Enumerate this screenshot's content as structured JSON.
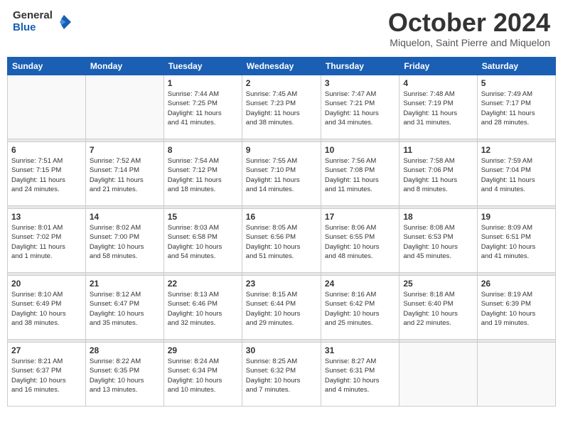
{
  "logo": {
    "general": "General",
    "blue": "Blue"
  },
  "title": "October 2024",
  "location": "Miquelon, Saint Pierre and Miquelon",
  "weekdays": [
    "Sunday",
    "Monday",
    "Tuesday",
    "Wednesday",
    "Thursday",
    "Friday",
    "Saturday"
  ],
  "weeks": [
    [
      {
        "day": "",
        "info": ""
      },
      {
        "day": "",
        "info": ""
      },
      {
        "day": "1",
        "info": "Sunrise: 7:44 AM\nSunset: 7:25 PM\nDaylight: 11 hours\nand 41 minutes."
      },
      {
        "day": "2",
        "info": "Sunrise: 7:45 AM\nSunset: 7:23 PM\nDaylight: 11 hours\nand 38 minutes."
      },
      {
        "day": "3",
        "info": "Sunrise: 7:47 AM\nSunset: 7:21 PM\nDaylight: 11 hours\nand 34 minutes."
      },
      {
        "day": "4",
        "info": "Sunrise: 7:48 AM\nSunset: 7:19 PM\nDaylight: 11 hours\nand 31 minutes."
      },
      {
        "day": "5",
        "info": "Sunrise: 7:49 AM\nSunset: 7:17 PM\nDaylight: 11 hours\nand 28 minutes."
      }
    ],
    [
      {
        "day": "6",
        "info": "Sunrise: 7:51 AM\nSunset: 7:15 PM\nDaylight: 11 hours\nand 24 minutes."
      },
      {
        "day": "7",
        "info": "Sunrise: 7:52 AM\nSunset: 7:14 PM\nDaylight: 11 hours\nand 21 minutes."
      },
      {
        "day": "8",
        "info": "Sunrise: 7:54 AM\nSunset: 7:12 PM\nDaylight: 11 hours\nand 18 minutes."
      },
      {
        "day": "9",
        "info": "Sunrise: 7:55 AM\nSunset: 7:10 PM\nDaylight: 11 hours\nand 14 minutes."
      },
      {
        "day": "10",
        "info": "Sunrise: 7:56 AM\nSunset: 7:08 PM\nDaylight: 11 hours\nand 11 minutes."
      },
      {
        "day": "11",
        "info": "Sunrise: 7:58 AM\nSunset: 7:06 PM\nDaylight: 11 hours\nand 8 minutes."
      },
      {
        "day": "12",
        "info": "Sunrise: 7:59 AM\nSunset: 7:04 PM\nDaylight: 11 hours\nand 4 minutes."
      }
    ],
    [
      {
        "day": "13",
        "info": "Sunrise: 8:01 AM\nSunset: 7:02 PM\nDaylight: 11 hours\nand 1 minute."
      },
      {
        "day": "14",
        "info": "Sunrise: 8:02 AM\nSunset: 7:00 PM\nDaylight: 10 hours\nand 58 minutes."
      },
      {
        "day": "15",
        "info": "Sunrise: 8:03 AM\nSunset: 6:58 PM\nDaylight: 10 hours\nand 54 minutes."
      },
      {
        "day": "16",
        "info": "Sunrise: 8:05 AM\nSunset: 6:56 PM\nDaylight: 10 hours\nand 51 minutes."
      },
      {
        "day": "17",
        "info": "Sunrise: 8:06 AM\nSunset: 6:55 PM\nDaylight: 10 hours\nand 48 minutes."
      },
      {
        "day": "18",
        "info": "Sunrise: 8:08 AM\nSunset: 6:53 PM\nDaylight: 10 hours\nand 45 minutes."
      },
      {
        "day": "19",
        "info": "Sunrise: 8:09 AM\nSunset: 6:51 PM\nDaylight: 10 hours\nand 41 minutes."
      }
    ],
    [
      {
        "day": "20",
        "info": "Sunrise: 8:10 AM\nSunset: 6:49 PM\nDaylight: 10 hours\nand 38 minutes."
      },
      {
        "day": "21",
        "info": "Sunrise: 8:12 AM\nSunset: 6:47 PM\nDaylight: 10 hours\nand 35 minutes."
      },
      {
        "day": "22",
        "info": "Sunrise: 8:13 AM\nSunset: 6:46 PM\nDaylight: 10 hours\nand 32 minutes."
      },
      {
        "day": "23",
        "info": "Sunrise: 8:15 AM\nSunset: 6:44 PM\nDaylight: 10 hours\nand 29 minutes."
      },
      {
        "day": "24",
        "info": "Sunrise: 8:16 AM\nSunset: 6:42 PM\nDaylight: 10 hours\nand 25 minutes."
      },
      {
        "day": "25",
        "info": "Sunrise: 8:18 AM\nSunset: 6:40 PM\nDaylight: 10 hours\nand 22 minutes."
      },
      {
        "day": "26",
        "info": "Sunrise: 8:19 AM\nSunset: 6:39 PM\nDaylight: 10 hours\nand 19 minutes."
      }
    ],
    [
      {
        "day": "27",
        "info": "Sunrise: 8:21 AM\nSunset: 6:37 PM\nDaylight: 10 hours\nand 16 minutes."
      },
      {
        "day": "28",
        "info": "Sunrise: 8:22 AM\nSunset: 6:35 PM\nDaylight: 10 hours\nand 13 minutes."
      },
      {
        "day": "29",
        "info": "Sunrise: 8:24 AM\nSunset: 6:34 PM\nDaylight: 10 hours\nand 10 minutes."
      },
      {
        "day": "30",
        "info": "Sunrise: 8:25 AM\nSunset: 6:32 PM\nDaylight: 10 hours\nand 7 minutes."
      },
      {
        "day": "31",
        "info": "Sunrise: 8:27 AM\nSunset: 6:31 PM\nDaylight: 10 hours\nand 4 minutes."
      },
      {
        "day": "",
        "info": ""
      },
      {
        "day": "",
        "info": ""
      }
    ]
  ]
}
